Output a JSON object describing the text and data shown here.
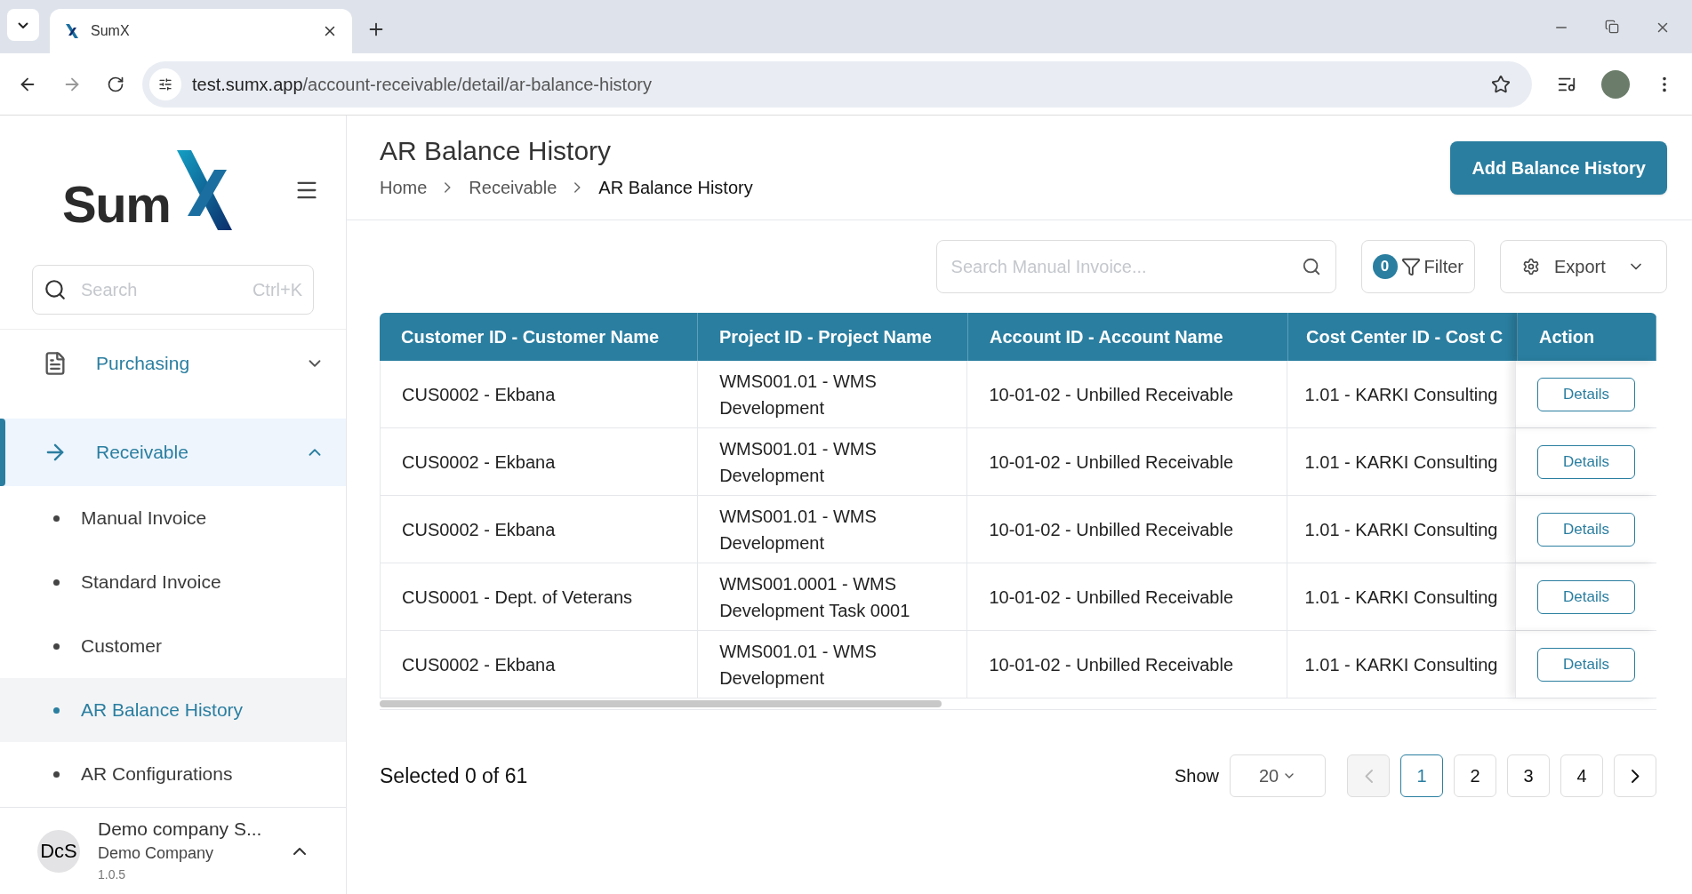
{
  "browser": {
    "tab_title": "SumX",
    "url_host": "test.sumx.app",
    "url_path": "/account-receivable/detail/ar-balance-history"
  },
  "logo": {
    "text": "Sum"
  },
  "sidebar": {
    "search": {
      "placeholder": "Search",
      "shortcut": "Ctrl+K"
    },
    "items": [
      {
        "label": "Purchasing",
        "selected": false,
        "expanded": false
      },
      {
        "label": "Receivable",
        "selected": true,
        "expanded": true,
        "children": [
          {
            "label": "Manual Invoice",
            "selected": false
          },
          {
            "label": "Standard Invoice",
            "selected": false
          },
          {
            "label": "Customer",
            "selected": false
          },
          {
            "label": "AR Balance History",
            "selected": true
          },
          {
            "label": "AR Configurations",
            "selected": false
          }
        ]
      }
    ],
    "account": {
      "initials": "DcS",
      "name": "Demo company S...",
      "company": "Demo Company",
      "version": "1.0.5"
    }
  },
  "page": {
    "title": "AR Balance History",
    "breadcrumb": [
      "Home",
      "Receivable",
      "AR Balance History"
    ],
    "primary_button": "Add Balance History"
  },
  "toolbar": {
    "search_placeholder": "Search Manual Invoice...",
    "filter_count": "0",
    "filter_label": "Filter",
    "export_label": "Export"
  },
  "table": {
    "columns": [
      "Customer ID - Customer Name",
      "Project ID - Project Name",
      "Account ID - Account Name",
      "Cost Center ID - Cost C",
      "Action"
    ],
    "rows": [
      {
        "cells": [
          "CUS0002 - Ekbana",
          "WMS001.01 - WMS Development",
          "10-01-02 - Unbilled Receivable",
          "1.01 - KARKI Consulting"
        ],
        "action": "Details"
      },
      {
        "cells": [
          "CUS0002 - Ekbana",
          "WMS001.01 - WMS Development",
          "10-01-02 - Unbilled Receivable",
          "1.01 - KARKI Consulting"
        ],
        "action": "Details"
      },
      {
        "cells": [
          "CUS0002 - Ekbana",
          "WMS001.01 - WMS Development",
          "10-01-02 - Unbilled Receivable",
          "1.01 - KARKI Consulting"
        ],
        "action": "Details"
      },
      {
        "cells": [
          "CUS0001 - Dept. of Veterans",
          "WMS001.0001 - WMS Development Task 0001",
          "10-01-02 - Unbilled Receivable",
          "1.01 - KARKI Consulting"
        ],
        "action": "Details"
      },
      {
        "cells": [
          "CUS0002 - Ekbana",
          "WMS001.01 - WMS Development",
          "10-01-02 - Unbilled Receivable",
          "1.01 - KARKI Consulting"
        ],
        "action": "Details"
      }
    ]
  },
  "footer": {
    "selection": "Selected 0 of 61",
    "show_label": "Show",
    "page_size": "20",
    "prev_disabled": true,
    "pages": [
      {
        "label": "1",
        "selected": true
      },
      {
        "label": "2",
        "selected": false
      },
      {
        "label": "3",
        "selected": false
      },
      {
        "label": "4",
        "selected": false
      }
    ]
  }
}
